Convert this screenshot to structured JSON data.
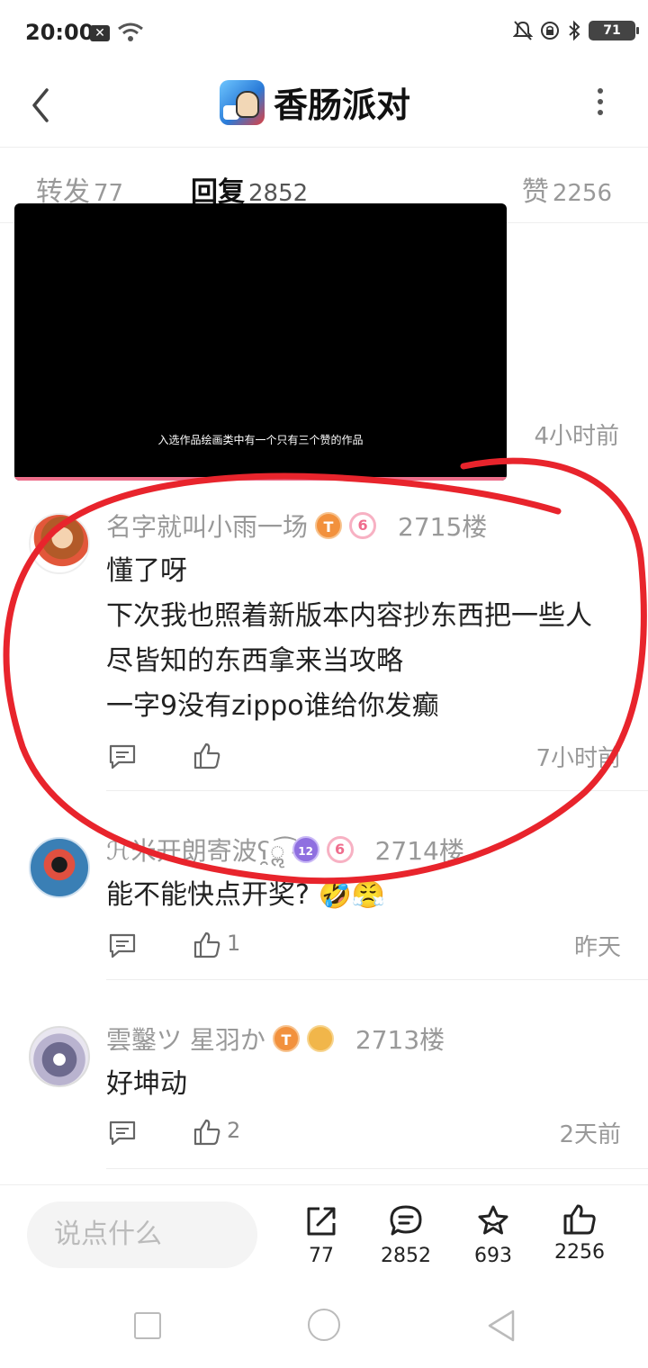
{
  "status_bar": {
    "time": "20:00",
    "notification_box": "✕",
    "battery": "71"
  },
  "header": {
    "title": "香肠派对",
    "back_icon": "chevron-left-icon",
    "more_icon": "more-vertical-icon"
  },
  "tabs": {
    "forward": {
      "label": "转发",
      "count": "77"
    },
    "reply": {
      "label": "回复",
      "count": "2852"
    },
    "like": {
      "label": "赞",
      "count": "2256"
    }
  },
  "video": {
    "caption": "入选作品绘画类中有一个只有三个赞的作品",
    "progress_color": "#ee6e8a"
  },
  "previous_time": "4小时前",
  "comments": [
    {
      "username": "名字就叫小雨一场",
      "floor": "2715楼",
      "lines": [
        "懂了呀",
        "下次我也照着新版本内容抄东西把一些人",
        "尽皆知的东西拿来当攻略",
        "一字9没有zippo谁给你发癫"
      ],
      "likes": "",
      "time": "7小时前",
      "badge_1": "T",
      "badge_2": "6"
    },
    {
      "username": "ℋ米开朗寄波ʕ̯ॢּ͡",
      "floor": "2714楼",
      "lines": [
        "能不能快点开奖? 🤣😤"
      ],
      "likes": "1",
      "time": "昨天",
      "badge_1": "12",
      "badge_2": "6"
    },
    {
      "username": "雲鑿ツ 星羽か",
      "floor": "2713楼",
      "lines": [
        "好坤动"
      ],
      "likes": "2",
      "time": "2天前",
      "badge_1": "T",
      "badge_2": ""
    }
  ],
  "bottom_bar": {
    "input_placeholder": "说点什么",
    "share_count": "77",
    "comment_count": "2852",
    "star_count": "693",
    "like_count": "2256"
  },
  "annotation_color": "#e8242c"
}
